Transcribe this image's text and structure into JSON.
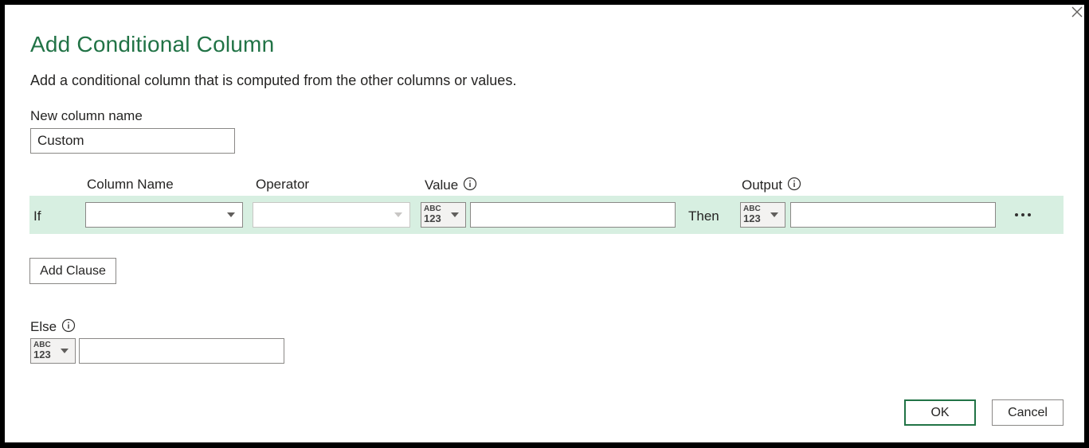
{
  "dialog": {
    "title": "Add Conditional Column",
    "description": "Add a conditional column that is computed from the other columns or values."
  },
  "new_column": {
    "label": "New column name",
    "value": "Custom"
  },
  "headers": {
    "column_name": "Column Name",
    "operator": "Operator",
    "value": "Value",
    "output": "Output"
  },
  "clause": {
    "if_label": "If",
    "then_label": "Then",
    "column_value": "",
    "operator_value": "",
    "value": "",
    "output": ""
  },
  "type_button": {
    "top": "ABC",
    "bottom": "123"
  },
  "add_clause_label": "Add Clause",
  "else": {
    "label": "Else",
    "value": ""
  },
  "buttons": {
    "ok": "OK",
    "cancel": "Cancel"
  },
  "icons": {
    "close": "close-icon",
    "info": "info-icon",
    "more": "more-icon",
    "caret": "chevron-down-icon"
  },
  "colors": {
    "accent": "#217346",
    "row_background": "#d7efe1"
  }
}
